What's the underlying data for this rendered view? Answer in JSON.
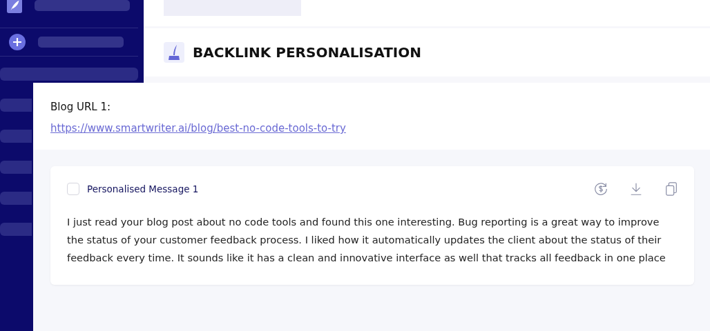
{
  "page_title": "BACKLINK PERSONALISATION",
  "blog": {
    "label": "Blog URL 1:",
    "url": "https://www.smartwriter.ai/blog/best-no-code-tools-to-try"
  },
  "messages": [
    {
      "title": "Personalised Message 1",
      "checked": false,
      "text": "I just read your blog post about no code tools and found this one interesting. Bug reporting is a great way to improve the status of your customer feedback process. I liked how it automatically updates the client about the status of their feedback every time. It sounds like it has a clean and innovative interface as well that tracks all feedback in one place"
    }
  ]
}
